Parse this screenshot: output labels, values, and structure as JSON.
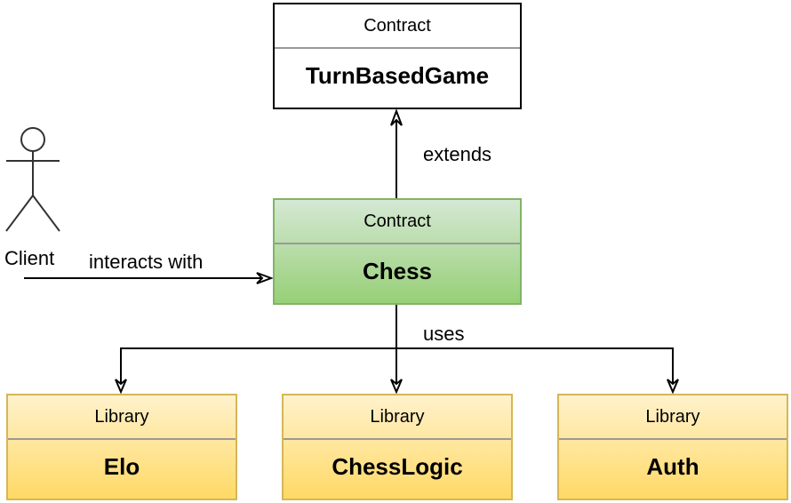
{
  "diagram": {
    "nodes": {
      "turnbasedgame": {
        "stereotype": "Contract",
        "name": "TurnBasedGame"
      },
      "chess": {
        "stereotype": "Contract",
        "name": "Chess"
      },
      "elo": {
        "stereotype": "Library",
        "name": "Elo"
      },
      "chesslogic": {
        "stereotype": "Library",
        "name": "ChessLogic"
      },
      "auth": {
        "stereotype": "Library",
        "name": "Auth"
      }
    },
    "actor": {
      "name": "Client"
    },
    "edges": {
      "extends": "extends",
      "interacts": "interacts with",
      "uses": "uses"
    },
    "colors": {
      "green_fill_top": "#d5e8d4",
      "green_fill_bottom": "#97d077",
      "green_border": "#82b366",
      "yellow_fill_top": "#fff2cc",
      "yellow_fill_bottom": "#ffd966",
      "yellow_border": "#d6b656"
    }
  }
}
